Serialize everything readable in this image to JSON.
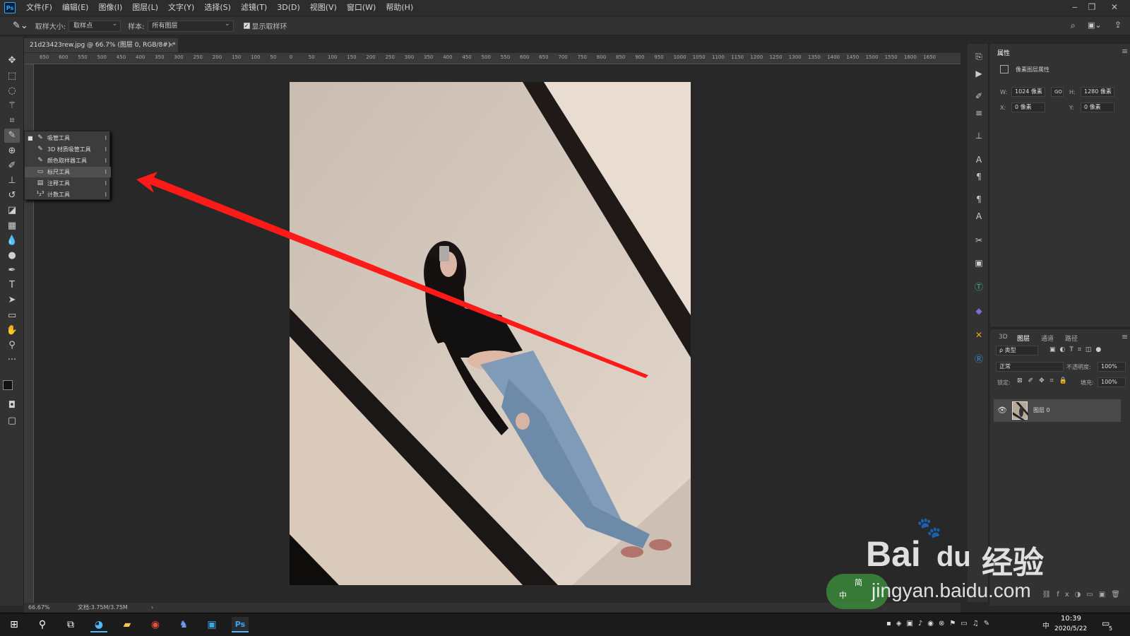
{
  "menubar": {
    "app_logo": "Ps",
    "items": [
      "文件(F)",
      "编辑(E)",
      "图像(I)",
      "图层(L)",
      "文字(Y)",
      "选择(S)",
      "滤镜(T)",
      "3D(D)",
      "视图(V)",
      "窗口(W)",
      "帮助(H)"
    ]
  },
  "options": {
    "sample_size_label": "取样大小:",
    "sample_size_value": "取样点",
    "sample_label": "样本:",
    "sample_value": "所有图层",
    "show_ring_label": "显示取样环",
    "show_ring_checked": true
  },
  "document": {
    "tab_title": "21d23423rew.jpg @ 66.7% (图层 0, RGB/8#) *",
    "zoom": "66.67%",
    "doc_size": "文档:3.75M/3.75M",
    "ruler_labels": [
      "650",
      "600",
      "550",
      "500",
      "450",
      "400",
      "350",
      "300",
      "250",
      "200",
      "150",
      "100",
      "50",
      "0",
      "50",
      "100",
      "150",
      "200",
      "250",
      "300",
      "350",
      "400",
      "450",
      "500",
      "550",
      "600",
      "650",
      "700",
      "750",
      "800",
      "850",
      "900",
      "950",
      "1000",
      "1050",
      "1100",
      "1150",
      "1200",
      "1250",
      "1300",
      "1350",
      "1400",
      "1450",
      "1500",
      "1550",
      "1600",
      "1650"
    ]
  },
  "flyout": {
    "items": [
      {
        "label": "吸管工具",
        "key": "I",
        "icon": "eyedropper-icon",
        "selected": false,
        "active": true
      },
      {
        "label": "3D 材质吸管工具",
        "key": "I",
        "icon": "3d-eyedropper-icon",
        "selected": false,
        "active": false
      },
      {
        "label": "颜色取样器工具",
        "key": "I",
        "icon": "color-sampler-icon",
        "selected": false,
        "active": false
      },
      {
        "label": "标尺工具",
        "key": "I",
        "icon": "ruler-icon",
        "selected": true,
        "active": false
      },
      {
        "label": "注释工具",
        "key": "I",
        "icon": "note-icon",
        "selected": false,
        "active": false
      },
      {
        "label": "计数工具",
        "key": "I",
        "icon": "count-icon",
        "selected": false,
        "active": false
      }
    ]
  },
  "properties": {
    "tab": "属性",
    "section": "像素图层属性",
    "w_label": "W:",
    "w_value": "1024 像素",
    "h_label": "H:",
    "h_value": "1280 像素",
    "link_label": "GO",
    "x_label": "X:",
    "x_value": "0 像素",
    "y_label": "Y:",
    "y_value": "0 像素"
  },
  "layers_panel": {
    "tabs": [
      "3D",
      "图层",
      "通道",
      "路径"
    ],
    "active_tab": "图层",
    "filter_label": "ρ 类型",
    "blend_mode": "正常",
    "opacity_label": "不透明度:",
    "opacity_value": "100%",
    "lock_label": "锁定:",
    "fill_label": "填充:",
    "fill_value": "100%",
    "layer_name": "图层 0"
  },
  "taskbar": {
    "time": "10:39",
    "date": "2020/5/22",
    "ime": "中",
    "notifications": "5"
  },
  "watermark": {
    "brand": "Bai",
    "brand2": "du",
    "cn": "经验",
    "url": "jingyan.baidu.com",
    "ime_top": "简",
    "ime_bottom": "中"
  },
  "colors": {
    "accent": "#31a8ff",
    "annotation_arrow": "#ff1a1a",
    "photo_wall": "#cfc3b6",
    "frame": "#1a1a1a"
  }
}
